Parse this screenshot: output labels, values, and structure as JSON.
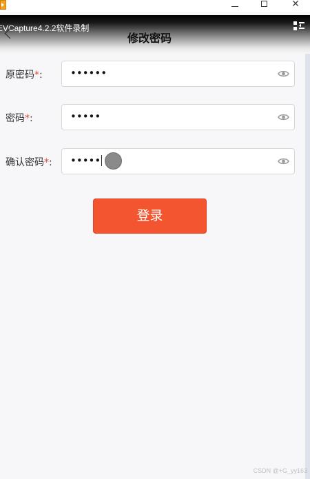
{
  "window": {
    "logo_icon": "app-logo-icon",
    "minimize_icon": "minimize-icon",
    "maximize_icon": "maximize-icon",
    "close_glyph": "✕"
  },
  "header": {
    "recorder_watermark": "EVCapture4.2.2软件录制",
    "title": "修改密码",
    "back_icon": "chevron-left-icon",
    "menu_icon": "menu-sort-icon"
  },
  "form": {
    "required_mark": "*",
    "colon": ":",
    "fields": [
      {
        "label": "原密码",
        "value": "••••••",
        "focused": false
      },
      {
        "label": "密码",
        "value": "•••••",
        "focused": false
      },
      {
        "label": "确认密码",
        "value": "•••••",
        "focused": true
      }
    ],
    "eye_icon": "eye-icon",
    "submit_label": "登录"
  },
  "colors": {
    "accent": "#f35530",
    "required": "#e14a3a",
    "background": "#f7f7f9",
    "eye": "#9a9a9a"
  },
  "footer": {
    "watermark": "CSDN @+G_yy163"
  }
}
